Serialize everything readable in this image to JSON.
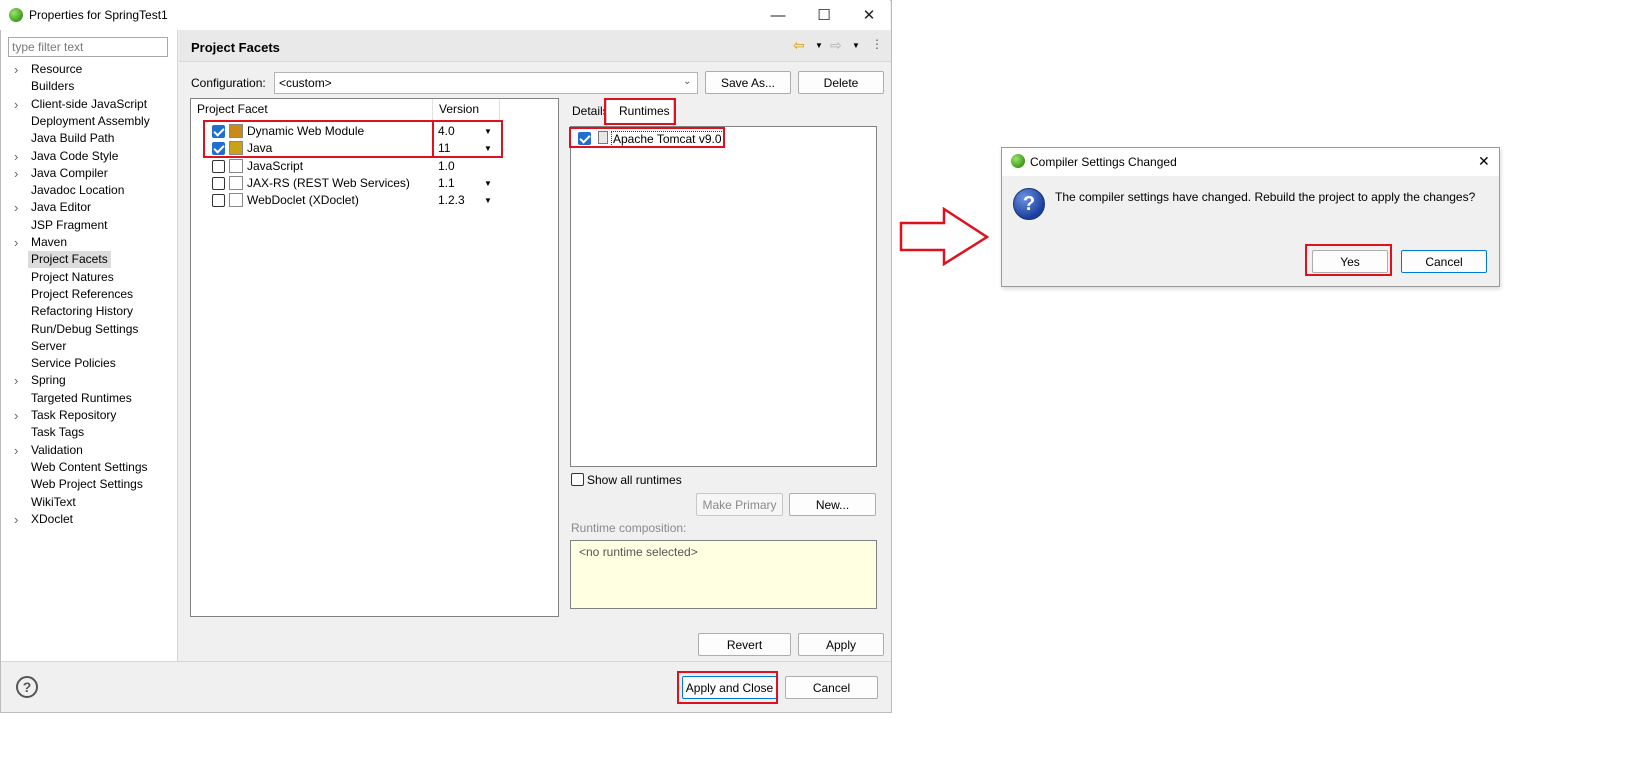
{
  "window": {
    "title": "Properties for SpringTest1",
    "controls": {
      "minimize": "—",
      "maximize": "☐",
      "close": "✕"
    }
  },
  "sidebar": {
    "filter_placeholder": "type filter text",
    "items": [
      {
        "label": "Resource",
        "expandable": true
      },
      {
        "label": "Builders",
        "expandable": false
      },
      {
        "label": "Client-side JavaScript",
        "expandable": true
      },
      {
        "label": "Deployment Assembly",
        "expandable": false
      },
      {
        "label": "Java Build Path",
        "expandable": false
      },
      {
        "label": "Java Code Style",
        "expandable": true
      },
      {
        "label": "Java Compiler",
        "expandable": true
      },
      {
        "label": "Javadoc Location",
        "expandable": false
      },
      {
        "label": "Java Editor",
        "expandable": true
      },
      {
        "label": "JSP Fragment",
        "expandable": false
      },
      {
        "label": "Maven",
        "expandable": true
      },
      {
        "label": "Project Facets",
        "expandable": false,
        "selected": true
      },
      {
        "label": "Project Natures",
        "expandable": false
      },
      {
        "label": "Project References",
        "expandable": false
      },
      {
        "label": "Refactoring History",
        "expandable": false
      },
      {
        "label": "Run/Debug Settings",
        "expandable": false
      },
      {
        "label": "Server",
        "expandable": false
      },
      {
        "label": "Service Policies",
        "expandable": false
      },
      {
        "label": "Spring",
        "expandable": true
      },
      {
        "label": "Targeted Runtimes",
        "expandable": false
      },
      {
        "label": "Task Repository",
        "expandable": true
      },
      {
        "label": "Task Tags",
        "expandable": false
      },
      {
        "label": "Validation",
        "expandable": true
      },
      {
        "label": "Web Content Settings",
        "expandable": false
      },
      {
        "label": "Web Project Settings",
        "expandable": false
      },
      {
        "label": "WikiText",
        "expandable": false
      },
      {
        "label": "XDoclet",
        "expandable": true
      }
    ]
  },
  "page": {
    "title": "Project Facets",
    "configuration_label": "Configuration:",
    "configuration_value": "<custom>",
    "save_as": "Save As...",
    "delete": "Delete"
  },
  "facets": {
    "headers": {
      "facet": "Project Facet",
      "version": "Version"
    },
    "rows": [
      {
        "name": "Dynamic Web Module",
        "version": "4.0",
        "checked": true,
        "has_dropdown": true,
        "icon": "web-module-icon"
      },
      {
        "name": "Java",
        "version": "11",
        "checked": true,
        "has_dropdown": true,
        "icon": "java-icon"
      },
      {
        "name": "JavaScript",
        "version": "1.0",
        "checked": false,
        "has_dropdown": false,
        "icon": "document-icon"
      },
      {
        "name": "JAX-RS (REST Web Services)",
        "version": "1.1",
        "checked": false,
        "has_dropdown": true,
        "icon": "document-icon"
      },
      {
        "name": "WebDoclet (XDoclet)",
        "version": "1.2.3",
        "checked": false,
        "has_dropdown": true,
        "icon": "document-icon"
      }
    ]
  },
  "runtimes": {
    "tabs": {
      "details": "Details",
      "runtimes": "Runtimes"
    },
    "items": [
      {
        "name": "Apache Tomcat v9.0",
        "checked": true
      }
    ],
    "show_all": "Show all runtimes",
    "make_primary": "Make Primary",
    "new": "New...",
    "composition_label": "Runtime composition:",
    "composition_value": "<no runtime selected>"
  },
  "actions": {
    "revert": "Revert",
    "apply": "Apply",
    "apply_and_close": "Apply and Close",
    "cancel": "Cancel"
  },
  "dialog": {
    "title": "Compiler Settings Changed",
    "message": "The compiler settings have changed. Rebuild the project to apply the changes?",
    "yes": "Yes",
    "cancel": "Cancel",
    "close": "✕"
  },
  "colors": {
    "highlight": "#e0101e",
    "checkbox": "#1f6fce",
    "composition_bg": "#ffffe1"
  }
}
